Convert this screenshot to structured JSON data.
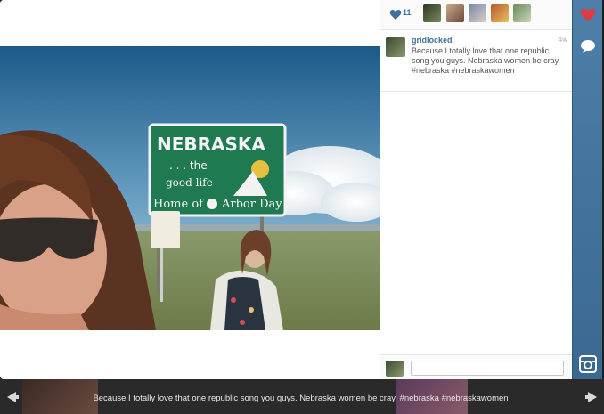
{
  "likes": {
    "count": "11",
    "likers": [
      "liker-1",
      "liker-2",
      "liker-3",
      "liker-4",
      "liker-5"
    ]
  },
  "caption": {
    "username": "gridlocked",
    "time": "4w",
    "text": "Because I totally love that one republic song you guys. Nebraska women be cray. #nebraska #nebraskawomen"
  },
  "photo": {
    "sign_line1": "NEBRASKA",
    "sign_line2": ". . . the",
    "sign_line3": "good life",
    "sign_line4": "Home of",
    "sign_line5": "Arbor Day"
  },
  "comment": {
    "placeholder": ""
  },
  "bottom": {
    "caption": "Because I totally love that one republic song you guys. Nebraska women be cray. #nebraska #nebraskawomen"
  },
  "icons": {
    "heart": "heart-icon",
    "comment": "comment-bubble-icon",
    "camera": "instagram-camera-icon",
    "prev": "left-arrow-icon",
    "next": "right-arrow-icon"
  },
  "colors": {
    "rail": "#4d7fa8",
    "like": "#e0393e",
    "link": "#3f729b"
  }
}
